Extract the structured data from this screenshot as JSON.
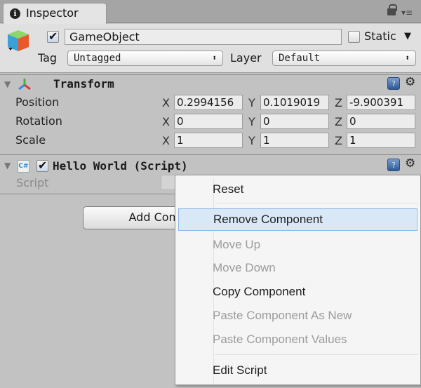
{
  "window": {
    "tab_label": "Inspector",
    "tab_icon": "info-icon",
    "lock_icon": "lock-icon",
    "menu_icon": "▾≡"
  },
  "gameobject": {
    "active": true,
    "name": "GameObject",
    "static_label": "Static",
    "static_checked": false,
    "static_arrow": "▼",
    "tag_label": "Tag",
    "tag_value": "Untagged",
    "layer_label": "Layer",
    "layer_value": "Default",
    "dropdown_arrow": "⬍"
  },
  "transform": {
    "title": "Transform",
    "fold": "▼",
    "help_glyph": "?",
    "gear_glyph": "⚙",
    "rows": [
      {
        "label": "Position",
        "x": "0.2994156",
        "y": "0.1019019",
        "z": "-9.900391"
      },
      {
        "label": "Rotation",
        "x": "0",
        "y": "0",
        "z": "0"
      },
      {
        "label": "Scale",
        "x": "1",
        "y": "1",
        "z": "1"
      }
    ],
    "axes": {
      "x": "X",
      "y": "Y",
      "z": "Z"
    }
  },
  "script_component": {
    "title": "Hello World (Script)",
    "enabled": true,
    "fold": "▼",
    "cs_glyph": "C#",
    "script_label": "Script",
    "help_glyph": "?",
    "gear_glyph": "⚙"
  },
  "add_component_label": "Add Component",
  "context_menu": {
    "items": [
      {
        "label": "Reset",
        "enabled": true
      },
      {
        "label": "Remove Component",
        "enabled": true,
        "highlighted": true
      },
      {
        "label": "Move Up",
        "enabled": false
      },
      {
        "label": "Move Down",
        "enabled": false
      },
      {
        "label": "Copy Component",
        "enabled": true
      },
      {
        "label": "Paste Component As New",
        "enabled": false
      },
      {
        "label": "Paste Component Values",
        "enabled": false
      },
      {
        "label": "Edit Script",
        "enabled": true
      }
    ]
  }
}
